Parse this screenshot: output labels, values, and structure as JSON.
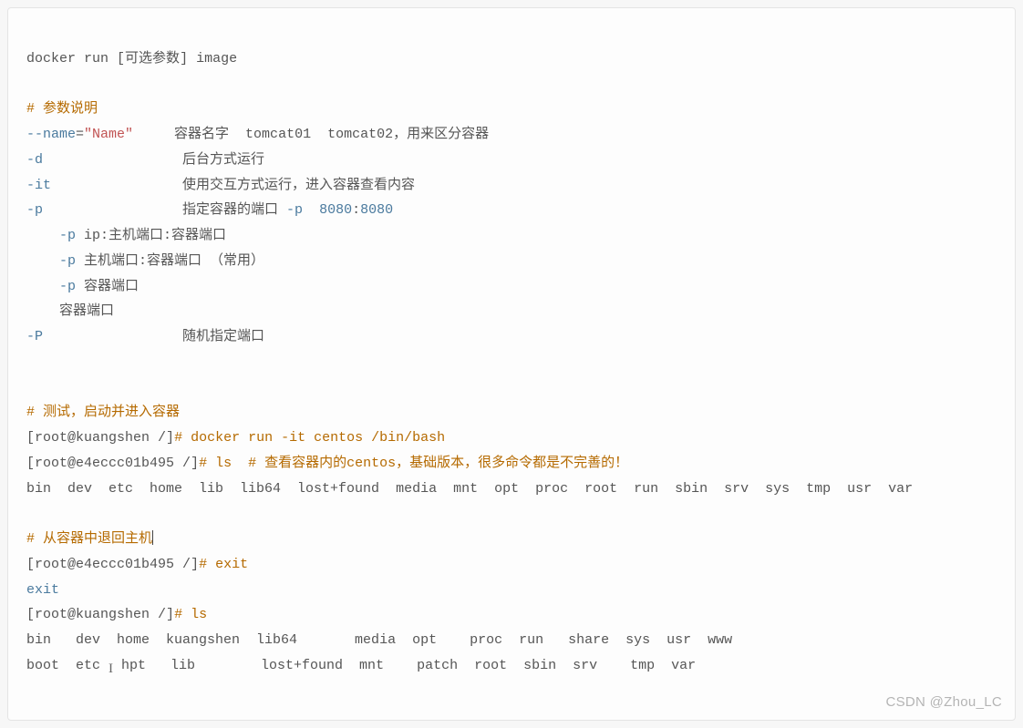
{
  "lines": {
    "l01a": "docker run ",
    "l01b": "[",
    "l01c": "可选参数",
    "l01d": "]",
    "l01e": " image",
    "l03": "# 参数说明",
    "l04a": "--name",
    "l04b": "=",
    "l04c": "\"Name\"",
    "l04d": "     容器名字  tomcat01  tomcat02，用来区分容器",
    "l05a": "-d",
    "l05b": "                 后台方式运行",
    "l06a": "-it",
    "l06b": "                使用交互方式运行，进入容器查看内容",
    "l07a": "-p",
    "l07b": "                 指定容器的端口 ",
    "l07c": "-p",
    "l07d": "  ",
    "l07e": "8080",
    "l07f": ":",
    "l07g": "8080",
    "l08a": "    -p",
    "l08b": " ip:主机端口:容器端口",
    "l09a": "    -p",
    "l09b": " 主机端口:容器端口 （常用）",
    "l10a": "    -p",
    "l10b": " 容器端口",
    "l11": "    容器端口",
    "l12a": "-P",
    "l12b": "                 随机指定端口",
    "l15": "# 测试，启动并进入容器",
    "l16a": "[",
    "l16b": "root@kuangshen /",
    "l16c": "]",
    "l16d": "# docker run -it centos /bin/bash",
    "l17a": "[",
    "l17b": "root@e4eccc01b495 /",
    "l17c": "]",
    "l17d": "# ls  # 查看容器内的centos，基础版本，很多命令都是不完善的！",
    "l18": "bin  dev  etc  home  lib  lib64  lost+found  media  mnt  opt  proc  root  run  sbin  srv  sys  tmp  usr  var",
    "l20": "# 从容器中退回主机",
    "l21a": "[",
    "l21b": "root@e4eccc01b495 /",
    "l21c": "]",
    "l21d": "# exit",
    "l22": "exit",
    "l23a": "[",
    "l23b": "root@kuangshen /",
    "l23c": "]",
    "l23d": "# ls",
    "l24": "bin   dev  home  kuangshen  lib64       media  opt    proc  run   share  sys  usr  www",
    "l25a": "boot  etc ",
    "l25b": " hpt   lib        lost+found  mnt    patch  root  sbin  srv    tmp  var"
  },
  "watermark": "CSDN @Zhou_LC"
}
